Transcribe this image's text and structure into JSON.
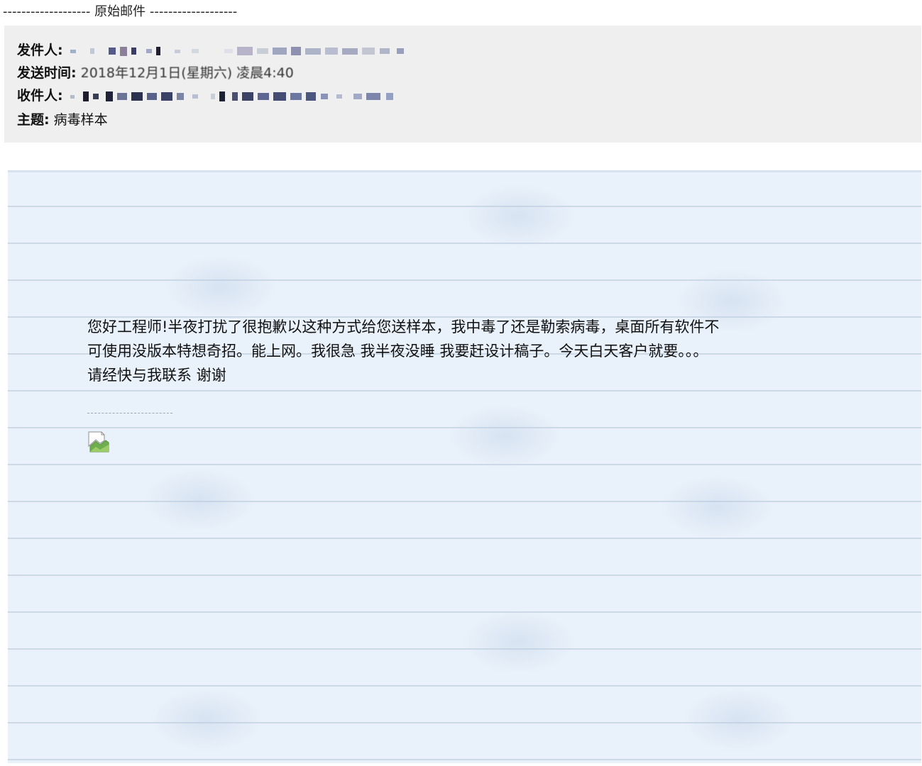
{
  "divider": {
    "dashes_left": "-------------------",
    "title": "原始邮件",
    "dashes_right": "-------------------"
  },
  "header": {
    "from_label": "发件人:",
    "sent_label": "发送时间:",
    "sent_value": "2018年12月1日(星期六) 凌晨4:40",
    "to_label": "收件人:",
    "subject_label": "主题:",
    "subject_value": "病毒样本"
  },
  "body": {
    "message_line1": "您好工程师!半夜打扰了很抱歉以这种方式给您送样本，我中毒了还是勒索病毒，桌面所有软件不",
    "message_line2": "可使用没版本特想奇招。能上网。我很急  我半夜没睡 我要赶设计稿子。今天白天客户就要。。。",
    "message_line3": "请经快与我联系 谢谢",
    "image_icon": "broken-image-icon"
  },
  "colors": {
    "header_bg": "#efefef",
    "paper_bg": "#e9f1fa",
    "paper_line": "#ccd9e7"
  }
}
